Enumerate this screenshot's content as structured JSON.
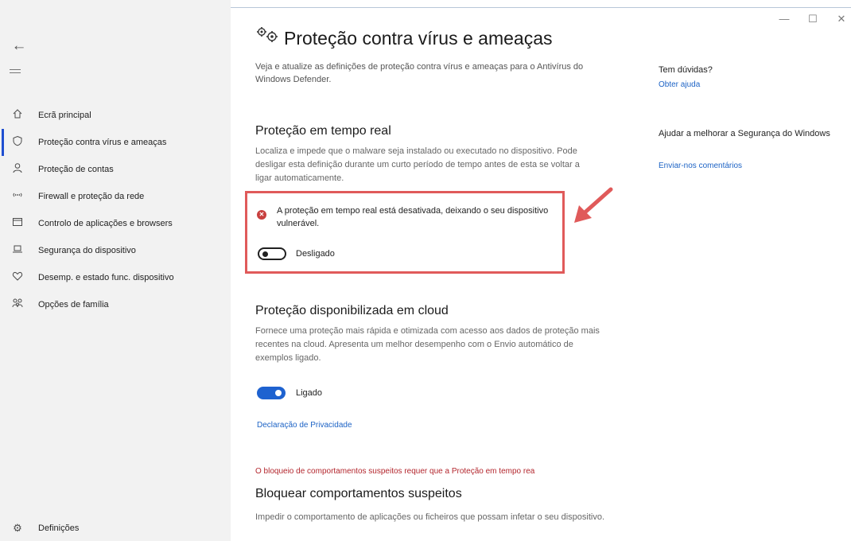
{
  "window": {
    "minimize_glyph": "—",
    "maximize_glyph": "☐",
    "close_glyph": "✕"
  },
  "sidebar": {
    "back_icon": "back-arrow-icon",
    "menu_icon": "hamburger-icon",
    "items": [
      {
        "label": "Ecrã principal",
        "icon": "home-icon"
      },
      {
        "label": "Proteção contra vírus e ameaças",
        "icon": "shield-icon",
        "active": true
      },
      {
        "label": "Proteção de contas",
        "icon": "person-icon"
      },
      {
        "label": "Firewall e proteção da rede",
        "icon": "wifi-icon"
      },
      {
        "label": "Controlo de aplicações e browsers",
        "icon": "app-window-icon"
      },
      {
        "label": "Segurança do dispositivo",
        "icon": "laptop-icon"
      },
      {
        "label": "Desemp. e estado func. dispositivo",
        "icon": "heart-icon"
      },
      {
        "label": "Opções de família",
        "icon": "family-icon"
      }
    ],
    "settings": {
      "label": "Definições",
      "icon": "gear-icon"
    }
  },
  "page": {
    "title": "Proteção contra vírus e ameaças",
    "description": "Veja e atualize as definições de proteção contra vírus e ameaças para o Antivírus do Windows Defender."
  },
  "realtime": {
    "title": "Proteção em tempo real",
    "description": "Localiza e impede que o malware seja instalado ou executado no dispositivo. Pode desligar esta definição durante um curto período de tempo antes de esta se voltar a ligar automaticamente.",
    "alert": "A proteção em tempo real está desativada, deixando o seu dispositivo vulnerável.",
    "toggle_label": "Desligado",
    "toggle_on": false,
    "highlight_color": "#e05a5a"
  },
  "cloud": {
    "title": "Proteção disponibilizada em cloud",
    "description": "Fornece uma proteção mais rápida e otimizada com acesso aos dados de proteção mais recentes na cloud. Apresenta um melhor desempenho com o Envio automático de exemplos ligado.",
    "toggle_label": "Ligado",
    "toggle_on": true,
    "privacy_link": "Declaração de Privacidade"
  },
  "behavior": {
    "warning": "O bloqueio de comportamentos suspeitos requer que a Proteção em tempo rea",
    "title": "Bloquear comportamentos suspeitos",
    "description": "Impedir o comportamento de aplicações ou ficheiros que possam infetar o seu dispositivo."
  },
  "aside": {
    "help_heading": "Tem dúvidas?",
    "help_link": "Obter ajuda",
    "improve_heading": "Ajudar a melhorar a Segurança do Windows",
    "improve_link": "Enviar-nos comentários"
  },
  "colors": {
    "accent": "#1e62d0",
    "link": "#1d63c5",
    "error": "#b3262d"
  }
}
